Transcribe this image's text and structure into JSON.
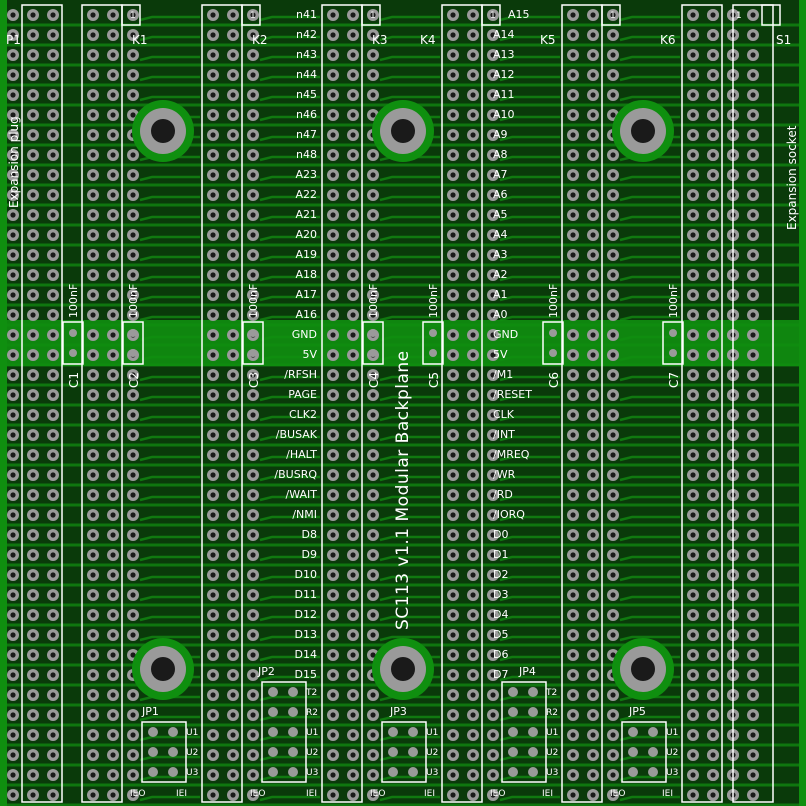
{
  "board_title": "SC113  v1.1 Modular Backplane",
  "edge_labels": {
    "left": "Expansion plug",
    "right": "Expansion socket"
  },
  "connectors": [
    "P1",
    "K1",
    "K2",
    "K3",
    "K4",
    "K5",
    "K6",
    "S1"
  ],
  "pin1_marker": "1",
  "signals_left": [
    "n41",
    "n42",
    "n43",
    "n44",
    "n45",
    "n46",
    "n47",
    "n48",
    "A23",
    "A22",
    "A21",
    "A20",
    "A19",
    "A18",
    "A17",
    "A16",
    "GND",
    "5V",
    "/RFSH",
    "PAGE",
    "CLK2",
    "/BUSAK",
    "/HALT",
    "/BUSRQ",
    "/WAIT",
    "/NMI",
    "D8",
    "D9",
    "D10",
    "D11",
    "D12",
    "D13",
    "D14",
    "D15"
  ],
  "signals_right": [
    "A15",
    "A14",
    "A13",
    "A12",
    "A11",
    "A10",
    "A9",
    "A8",
    "A7",
    "A6",
    "A5",
    "A4",
    "A3",
    "A2",
    "A1",
    "A0",
    "GND",
    "5V",
    "/M1",
    "/RESET",
    "CLK",
    "/INT",
    "/MREQ",
    "/WR",
    "/RD",
    "/IORQ",
    "D0",
    "D1",
    "D2",
    "D3",
    "D4",
    "D5",
    "D6",
    "D7"
  ],
  "capacitors": [
    {
      "ref": "C1",
      "value": "100nF"
    },
    {
      "ref": "C2",
      "value": "100nF"
    },
    {
      "ref": "C3",
      "value": "100nF"
    },
    {
      "ref": "C4",
      "value": "100nF"
    },
    {
      "ref": "C5",
      "value": "100nF"
    },
    {
      "ref": "C6",
      "value": "100nF"
    },
    {
      "ref": "C7",
      "value": "100nF"
    }
  ],
  "jumpers": [
    {
      "ref": "JP1",
      "pins": [
        "U1",
        "U2",
        "U3"
      ]
    },
    {
      "ref": "JP2",
      "pins": [
        "T2",
        "R2",
        "U1",
        "U2",
        "U3"
      ]
    },
    {
      "ref": "JP3",
      "pins": [
        "U1",
        "U2",
        "U3"
      ]
    },
    {
      "ref": "JP4",
      "pins": [
        "T2",
        "R2",
        "U1",
        "U2",
        "U3"
      ]
    },
    {
      "ref": "JP5",
      "pins": [
        "U1",
        "U2",
        "U3"
      ]
    }
  ],
  "chain_labels": {
    "out": "IEO",
    "in": "IEI"
  },
  "colors": {
    "board": "#0a3a0a",
    "copper": "#118a11",
    "pad": "#9a9a9a",
    "silk": "#ffffff",
    "edge": "#0f8f0f"
  }
}
